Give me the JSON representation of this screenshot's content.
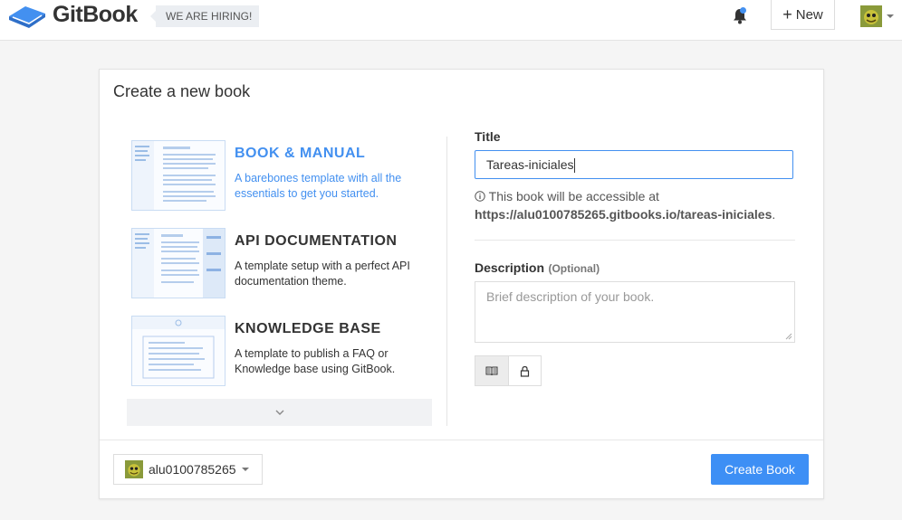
{
  "header": {
    "brand": "GitBook",
    "hiring_label": "WE ARE HIRING!",
    "new_label": "New",
    "notification_dot_color": "#4390f0"
  },
  "panel": {
    "title": "Create a new book",
    "templates": [
      {
        "name": "BOOK & MANUAL",
        "description": "A barebones template with all the essentials to get you started.",
        "selected": true
      },
      {
        "name": "API DOCUMENTATION",
        "description": "A template setup with a perfect API documentation theme.",
        "selected": false
      },
      {
        "name": "KNOWLEDGE BASE",
        "description": "A template to publish a FAQ or Knowledge base using GitBook.",
        "selected": false
      }
    ]
  },
  "form": {
    "title_label": "Title",
    "title_value": "Tareas-iniciales",
    "hint_text": "This book will be accessible at",
    "hint_url": "https://alu0100785265.gitbooks.io/tareas-iniciales",
    "hint_end": ".",
    "description_label": "Description",
    "description_optional": "(Optional)",
    "description_placeholder": "Brief description of your book.",
    "visibility": [
      "public-book-icon",
      "lock-icon"
    ]
  },
  "footer": {
    "owner": "alu0100785265",
    "create_label": "Create Book",
    "accent_color": "#3d8ff5"
  }
}
